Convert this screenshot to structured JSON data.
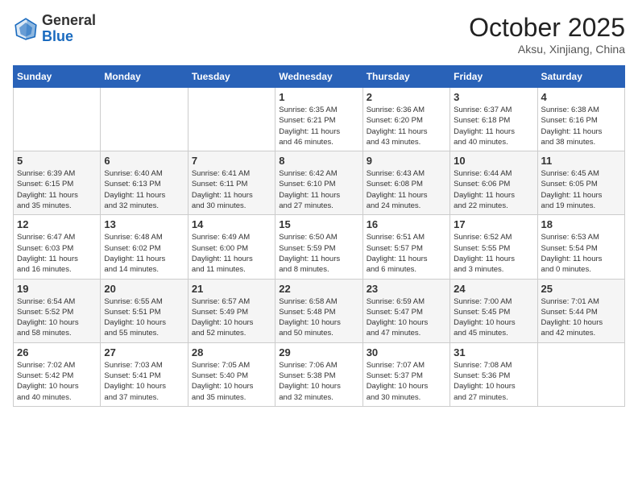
{
  "header": {
    "logo": {
      "general": "General",
      "blue": "Blue"
    },
    "title": "October 2025",
    "subtitle": "Aksu, Xinjiang, China"
  },
  "weekdays": [
    "Sunday",
    "Monday",
    "Tuesday",
    "Wednesday",
    "Thursday",
    "Friday",
    "Saturday"
  ],
  "weeks": [
    [
      {
        "day": "",
        "info": ""
      },
      {
        "day": "",
        "info": ""
      },
      {
        "day": "",
        "info": ""
      },
      {
        "day": "1",
        "info": "Sunrise: 6:35 AM\nSunset: 6:21 PM\nDaylight: 11 hours\nand 46 minutes."
      },
      {
        "day": "2",
        "info": "Sunrise: 6:36 AM\nSunset: 6:20 PM\nDaylight: 11 hours\nand 43 minutes."
      },
      {
        "day": "3",
        "info": "Sunrise: 6:37 AM\nSunset: 6:18 PM\nDaylight: 11 hours\nand 40 minutes."
      },
      {
        "day": "4",
        "info": "Sunrise: 6:38 AM\nSunset: 6:16 PM\nDaylight: 11 hours\nand 38 minutes."
      }
    ],
    [
      {
        "day": "5",
        "info": "Sunrise: 6:39 AM\nSunset: 6:15 PM\nDaylight: 11 hours\nand 35 minutes."
      },
      {
        "day": "6",
        "info": "Sunrise: 6:40 AM\nSunset: 6:13 PM\nDaylight: 11 hours\nand 32 minutes."
      },
      {
        "day": "7",
        "info": "Sunrise: 6:41 AM\nSunset: 6:11 PM\nDaylight: 11 hours\nand 30 minutes."
      },
      {
        "day": "8",
        "info": "Sunrise: 6:42 AM\nSunset: 6:10 PM\nDaylight: 11 hours\nand 27 minutes."
      },
      {
        "day": "9",
        "info": "Sunrise: 6:43 AM\nSunset: 6:08 PM\nDaylight: 11 hours\nand 24 minutes."
      },
      {
        "day": "10",
        "info": "Sunrise: 6:44 AM\nSunset: 6:06 PM\nDaylight: 11 hours\nand 22 minutes."
      },
      {
        "day": "11",
        "info": "Sunrise: 6:45 AM\nSunset: 6:05 PM\nDaylight: 11 hours\nand 19 minutes."
      }
    ],
    [
      {
        "day": "12",
        "info": "Sunrise: 6:47 AM\nSunset: 6:03 PM\nDaylight: 11 hours\nand 16 minutes."
      },
      {
        "day": "13",
        "info": "Sunrise: 6:48 AM\nSunset: 6:02 PM\nDaylight: 11 hours\nand 14 minutes."
      },
      {
        "day": "14",
        "info": "Sunrise: 6:49 AM\nSunset: 6:00 PM\nDaylight: 11 hours\nand 11 minutes."
      },
      {
        "day": "15",
        "info": "Sunrise: 6:50 AM\nSunset: 5:59 PM\nDaylight: 11 hours\nand 8 minutes."
      },
      {
        "day": "16",
        "info": "Sunrise: 6:51 AM\nSunset: 5:57 PM\nDaylight: 11 hours\nand 6 minutes."
      },
      {
        "day": "17",
        "info": "Sunrise: 6:52 AM\nSunset: 5:55 PM\nDaylight: 11 hours\nand 3 minutes."
      },
      {
        "day": "18",
        "info": "Sunrise: 6:53 AM\nSunset: 5:54 PM\nDaylight: 11 hours\nand 0 minutes."
      }
    ],
    [
      {
        "day": "19",
        "info": "Sunrise: 6:54 AM\nSunset: 5:52 PM\nDaylight: 10 hours\nand 58 minutes."
      },
      {
        "day": "20",
        "info": "Sunrise: 6:55 AM\nSunset: 5:51 PM\nDaylight: 10 hours\nand 55 minutes."
      },
      {
        "day": "21",
        "info": "Sunrise: 6:57 AM\nSunset: 5:49 PM\nDaylight: 10 hours\nand 52 minutes."
      },
      {
        "day": "22",
        "info": "Sunrise: 6:58 AM\nSunset: 5:48 PM\nDaylight: 10 hours\nand 50 minutes."
      },
      {
        "day": "23",
        "info": "Sunrise: 6:59 AM\nSunset: 5:47 PM\nDaylight: 10 hours\nand 47 minutes."
      },
      {
        "day": "24",
        "info": "Sunrise: 7:00 AM\nSunset: 5:45 PM\nDaylight: 10 hours\nand 45 minutes."
      },
      {
        "day": "25",
        "info": "Sunrise: 7:01 AM\nSunset: 5:44 PM\nDaylight: 10 hours\nand 42 minutes."
      }
    ],
    [
      {
        "day": "26",
        "info": "Sunrise: 7:02 AM\nSunset: 5:42 PM\nDaylight: 10 hours\nand 40 minutes."
      },
      {
        "day": "27",
        "info": "Sunrise: 7:03 AM\nSunset: 5:41 PM\nDaylight: 10 hours\nand 37 minutes."
      },
      {
        "day": "28",
        "info": "Sunrise: 7:05 AM\nSunset: 5:40 PM\nDaylight: 10 hours\nand 35 minutes."
      },
      {
        "day": "29",
        "info": "Sunrise: 7:06 AM\nSunset: 5:38 PM\nDaylight: 10 hours\nand 32 minutes."
      },
      {
        "day": "30",
        "info": "Sunrise: 7:07 AM\nSunset: 5:37 PM\nDaylight: 10 hours\nand 30 minutes."
      },
      {
        "day": "31",
        "info": "Sunrise: 7:08 AM\nSunset: 5:36 PM\nDaylight: 10 hours\nand 27 minutes."
      },
      {
        "day": "",
        "info": ""
      }
    ]
  ]
}
